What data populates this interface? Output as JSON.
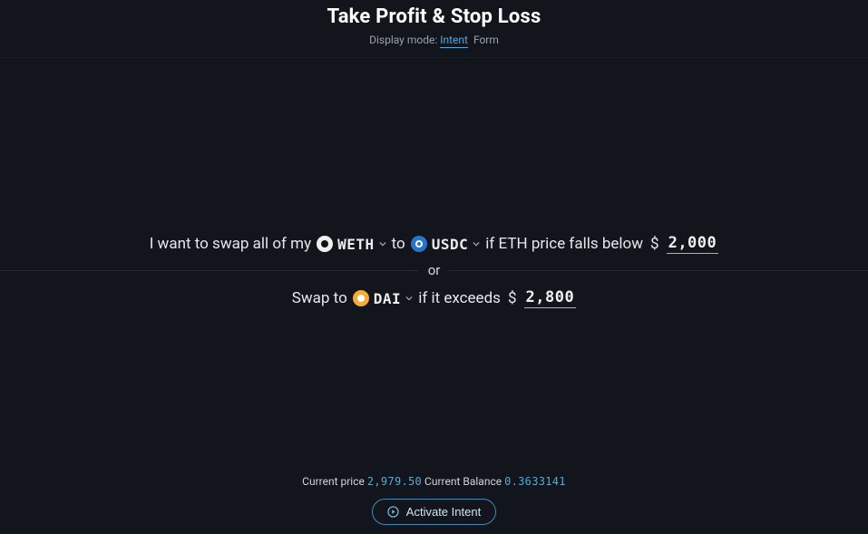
{
  "header": {
    "title": "Take Profit & Stop Loss",
    "displayModeLabel": "Display mode:",
    "intentLabel": "Intent",
    "formLabel": "Form"
  },
  "intent": {
    "line1_prefix": "I want to swap all of my",
    "line1_to": "to",
    "line1_condition": "if ETH price falls below",
    "line1_priceValue": "2,000",
    "line2_prefix": "Swap to",
    "line2_condition": "if it exceeds",
    "line2_priceValue": "2,800",
    "orLabel": "or",
    "dollar": "$"
  },
  "tokens": {
    "from": {
      "symbol": "WETH"
    },
    "to1": {
      "symbol": "USDC"
    },
    "to2": {
      "symbol": "DAI"
    }
  },
  "footer": {
    "currentPriceLabel": "Current price",
    "currentPriceValue": "2,979.50",
    "currentBalanceLabel": "Current Balance",
    "currentBalanceValue": "0.3633141",
    "activateLabel": "Activate Intent"
  }
}
